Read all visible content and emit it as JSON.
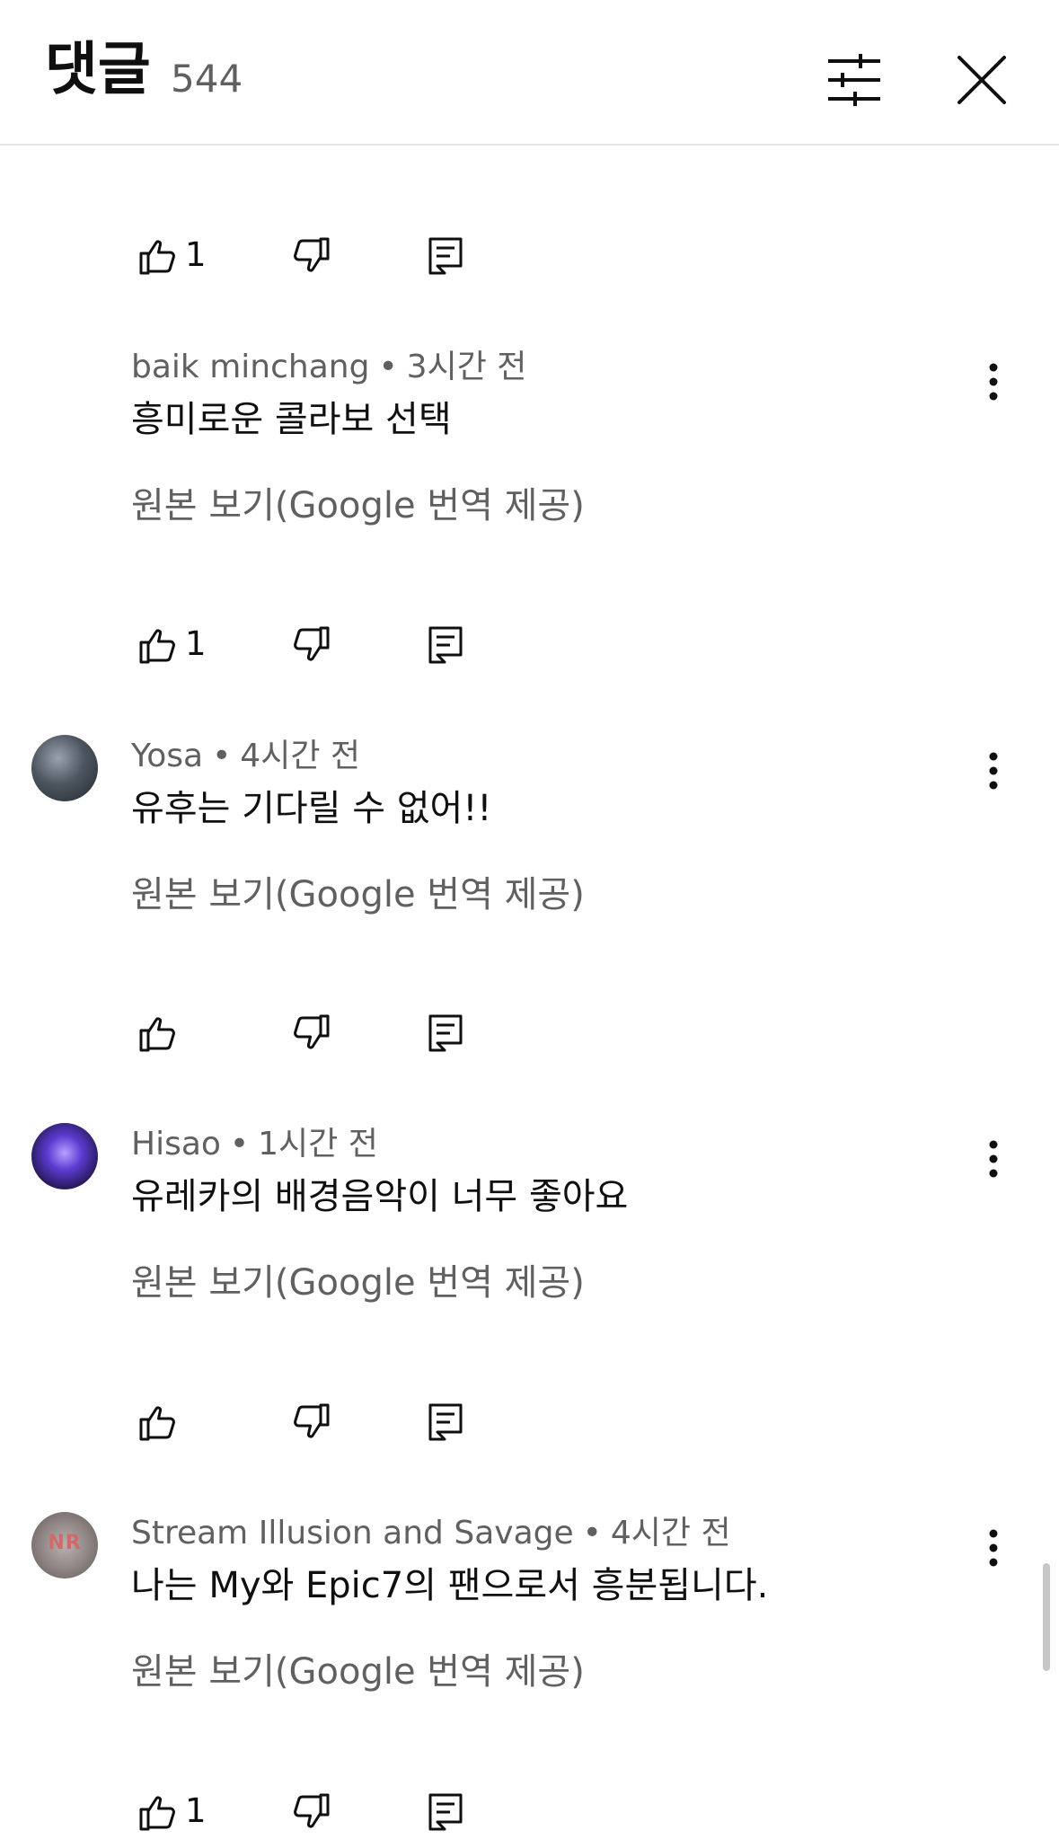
{
  "header": {
    "title": "댓글",
    "count": "544"
  },
  "top_actions": {
    "like_count": "1"
  },
  "comments": [
    {
      "author": "baik minchang",
      "time": "3시간 전",
      "text": "흥미로운 콜라보 선택",
      "translate_label": "원본 보기(Google 번역 제공)",
      "like_count": "1",
      "has_avatar": false
    },
    {
      "author": "Yosa",
      "time": "4시간 전",
      "text": "유후는 기다릴 수 없어!!",
      "translate_label": "원본 보기(Google 번역 제공)",
      "like_count": "",
      "has_avatar": true
    },
    {
      "author": "Hisao",
      "time": "1시간 전",
      "text": "유레카의 배경음악이 너무 좋아요",
      "translate_label": "원본 보기(Google 번역 제공)",
      "like_count": "",
      "has_avatar": true
    },
    {
      "author": "Stream Illusion and Savage",
      "time": "4시간 전",
      "text": "나는 My와 Epic7의 팬으로서 흥분됩니다.",
      "translate_label": "원본 보기(Google 번역 제공)",
      "like_count": "1",
      "has_avatar": true
    }
  ],
  "separator": "•",
  "icons": {
    "filter": "sliders-icon",
    "close": "close-icon",
    "like": "thumbs-up-icon",
    "dislike": "thumbs-down-icon",
    "reply": "reply-comment-icon",
    "more": "more-vertical-icon"
  },
  "colors": {
    "primary_text": "#0f0f0f",
    "secondary_text": "#606060",
    "divider": "#e5e5e5"
  }
}
